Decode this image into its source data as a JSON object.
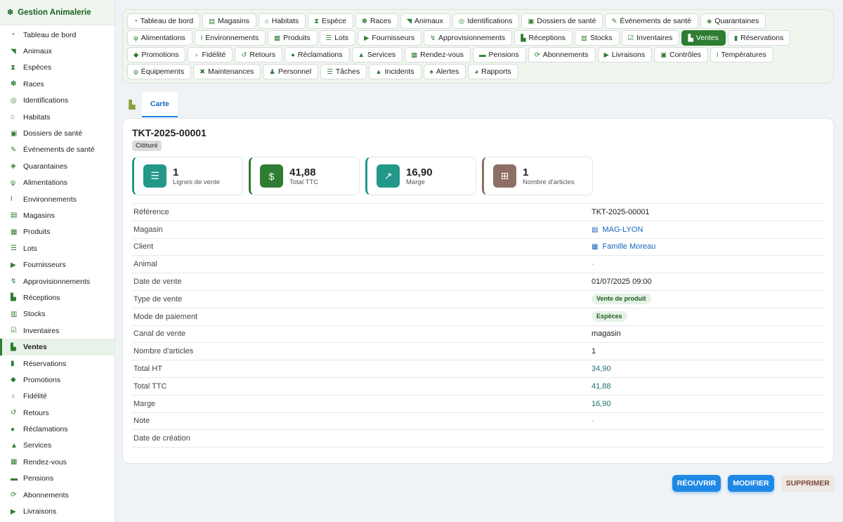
{
  "sidebar": {
    "brand": {
      "icon": "✽",
      "label": "Gestion Animalerie"
    },
    "items": [
      {
        "label": "Tableau de bord",
        "icon": "◔",
        "name": "sidebar-item-tableau-de-bord"
      },
      {
        "label": "Animaux",
        "icon": "◥",
        "name": "sidebar-item-animaux"
      },
      {
        "label": "Espèces",
        "icon": "⧗",
        "name": "sidebar-item-especes"
      },
      {
        "label": "Races",
        "icon": "✽",
        "name": "sidebar-item-races"
      },
      {
        "label": "Identifications",
        "icon": "◎",
        "name": "sidebar-item-identifications"
      },
      {
        "label": "Habitats",
        "icon": "⌂",
        "name": "sidebar-item-habitats"
      },
      {
        "label": "Dossiers de santé",
        "icon": "▣",
        "name": "sidebar-item-dossiers-de-sante"
      },
      {
        "label": "Événements de santé",
        "icon": "✎",
        "name": "sidebar-item-evenements-de-sante"
      },
      {
        "label": "Quarantaines",
        "icon": "◈",
        "name": "sidebar-item-quarantaines"
      },
      {
        "label": "Alimentations",
        "icon": "ψ",
        "name": "sidebar-item-alimentations"
      },
      {
        "label": "Environnements",
        "icon": "ǀ",
        "name": "sidebar-item-environnements"
      },
      {
        "label": "Magasins",
        "icon": "▤",
        "name": "sidebar-item-magasins"
      },
      {
        "label": "Produits",
        "icon": "▦",
        "name": "sidebar-item-produits"
      },
      {
        "label": "Lots",
        "icon": "☰",
        "name": "sidebar-item-lots"
      },
      {
        "label": "Fournisseurs",
        "icon": "▶",
        "name": "sidebar-item-fournisseurs"
      },
      {
        "label": "Approvisionnements",
        "icon": "↯",
        "name": "sidebar-item-approvisionnements"
      },
      {
        "label": "Réceptions",
        "icon": "▙",
        "name": "sidebar-item-receptions"
      },
      {
        "label": "Stocks",
        "icon": "▥",
        "name": "sidebar-item-stocks"
      },
      {
        "label": "Inventaires",
        "icon": "☑",
        "name": "sidebar-item-inventaires"
      },
      {
        "label": "Ventes",
        "icon": "▙",
        "name": "sidebar-item-ventes",
        "active": true
      },
      {
        "label": "Réservations",
        "icon": "▮",
        "name": "sidebar-item-reservations"
      },
      {
        "label": "Promotions",
        "icon": "◆",
        "name": "sidebar-item-promotions"
      },
      {
        "label": "Fidélité",
        "icon": "♁",
        "name": "sidebar-item-fidelite"
      },
      {
        "label": "Retours",
        "icon": "↺",
        "name": "sidebar-item-retours"
      },
      {
        "label": "Réclamations",
        "icon": "●",
        "name": "sidebar-item-reclamations"
      },
      {
        "label": "Services",
        "icon": "▲",
        "name": "sidebar-item-services"
      },
      {
        "label": "Rendez-vous",
        "icon": "▦",
        "name": "sidebar-item-rendez-vous"
      },
      {
        "label": "Pensions",
        "icon": "▬",
        "name": "sidebar-item-pensions"
      },
      {
        "label": "Abonnements",
        "icon": "⟳",
        "name": "sidebar-item-abonnements"
      },
      {
        "label": "Livraisons",
        "icon": "▶",
        "name": "sidebar-item-livraisons"
      }
    ]
  },
  "chips": [
    {
      "label": "Tableau de bord",
      "icon": "◔",
      "name": "chip-tableau-de-bord"
    },
    {
      "label": "Magasins",
      "icon": "▤",
      "name": "chip-magasins"
    },
    {
      "label": "Habitats",
      "icon": "⌂",
      "name": "chip-habitats"
    },
    {
      "label": "Espèce",
      "icon": "⧗",
      "name": "chip-espece"
    },
    {
      "label": "Races",
      "icon": "✽",
      "name": "chip-races"
    },
    {
      "label": "Animaux",
      "icon": "◥",
      "name": "chip-animaux"
    },
    {
      "label": "Identifications",
      "icon": "◎",
      "name": "chip-identifications"
    },
    {
      "label": "Dossiers de santé",
      "icon": "▣",
      "name": "chip-dossiers-de-sante"
    },
    {
      "label": "Événements de santé",
      "icon": "✎",
      "name": "chip-evenements-de-sante"
    },
    {
      "label": "Quarantaines",
      "icon": "◈",
      "name": "chip-quarantaines"
    },
    {
      "label": "Alimentations",
      "icon": "ψ",
      "name": "chip-alimentations"
    },
    {
      "label": "Environnements",
      "icon": "ǀ",
      "name": "chip-environnements"
    },
    {
      "label": "Produits",
      "icon": "▦",
      "name": "chip-produits"
    },
    {
      "label": "Lots",
      "icon": "☰",
      "name": "chip-lots"
    },
    {
      "label": "Fournisseurs",
      "icon": "▶",
      "name": "chip-fournisseurs"
    },
    {
      "label": "Approvisionnements",
      "icon": "↯",
      "name": "chip-approvisionnements"
    },
    {
      "label": "Réceptions",
      "icon": "▙",
      "name": "chip-receptions"
    },
    {
      "label": "Stocks",
      "icon": "▥",
      "name": "chip-stocks"
    },
    {
      "label": "Inventaires",
      "icon": "☑",
      "name": "chip-inventaires"
    },
    {
      "label": "Ventes",
      "icon": "▙",
      "name": "chip-ventes",
      "active": true
    },
    {
      "label": "Réservations",
      "icon": "▮",
      "name": "chip-reservations"
    },
    {
      "label": "Promotions",
      "icon": "◆",
      "name": "chip-promotions"
    },
    {
      "label": "Fidélité",
      "icon": "♁",
      "name": "chip-fidelite"
    },
    {
      "label": "Retours",
      "icon": "↺",
      "name": "chip-retours"
    },
    {
      "label": "Réclamations",
      "icon": "●",
      "name": "chip-reclamations"
    },
    {
      "label": "Services",
      "icon": "▲",
      "name": "chip-services"
    },
    {
      "label": "Rendez-vous",
      "icon": "▦",
      "name": "chip-rendez-vous"
    },
    {
      "label": "Pensions",
      "icon": "▬",
      "name": "chip-pensions"
    },
    {
      "label": "Abonnements",
      "icon": "⟳",
      "name": "chip-abonnements"
    },
    {
      "label": "Livraisons",
      "icon": "▶",
      "name": "chip-livraisons"
    },
    {
      "label": "Contrôles",
      "icon": "▣",
      "name": "chip-controles"
    },
    {
      "label": "Températures",
      "icon": "ǀ",
      "name": "chip-temperatures"
    },
    {
      "label": "Équipements",
      "icon": "ψ",
      "name": "chip-equipements"
    },
    {
      "label": "Maintenances",
      "icon": "✖",
      "name": "chip-maintenances"
    },
    {
      "label": "Personnel",
      "icon": "♟",
      "name": "chip-personnel"
    },
    {
      "label": "Tâches",
      "icon": "☰",
      "name": "chip-taches"
    },
    {
      "label": "Incidents",
      "icon": "▲",
      "name": "chip-incidents"
    },
    {
      "label": "Alertes",
      "icon": "♠",
      "name": "chip-alertes"
    },
    {
      "label": "Rapports",
      "icon": "◕",
      "name": "chip-rapports"
    }
  ],
  "tabs": {
    "icon": "▙",
    "carte": "Carte"
  },
  "record": {
    "title": "TKT-2025-00001",
    "status": "Clôturé",
    "kpis": [
      {
        "value": "1",
        "label": "Lignes de vente",
        "icon": "☰",
        "icon_name": "list-icon",
        "bg": "#22978a",
        "border": "#22978a"
      },
      {
        "value": "41,88",
        "label": "Total TTC",
        "icon": "$",
        "icon_name": "coins-icon",
        "bg": "#2e7d32",
        "border": "#2e7d32"
      },
      {
        "value": "16,90",
        "label": "Marge",
        "icon": "↗",
        "icon_name": "chart-line-icon",
        "bg": "#22978a",
        "border": "#22978a"
      },
      {
        "value": "1",
        "label": "Nombre d'articles",
        "icon": "⊞",
        "icon_name": "basket-icon",
        "bg": "#8d6e63",
        "border": "#8d6e63"
      }
    ],
    "rows": [
      {
        "key": "Référence",
        "value": "TKT-2025-00001",
        "type": "text"
      },
      {
        "key": "Magasin",
        "value": "MAG-LYON",
        "type": "link",
        "icon": "▤"
      },
      {
        "key": "Client",
        "value": "Famille Moreau",
        "type": "link",
        "icon": "▦"
      },
      {
        "key": "Animal",
        "value": "-",
        "type": "muted"
      },
      {
        "key": "Date de vente",
        "value": "01/07/2025 09:00",
        "type": "text"
      },
      {
        "key": "Type de vente",
        "value": "Vente de produit",
        "type": "pill"
      },
      {
        "key": "Mode de paiement",
        "value": "Espèces",
        "type": "pill"
      },
      {
        "key": "Canal de vente",
        "value": "magasin",
        "type": "text"
      },
      {
        "key": "Nombre d'articles",
        "value": "1",
        "type": "text"
      },
      {
        "key": "Total HT",
        "value": "34,90",
        "type": "teal"
      },
      {
        "key": "Total TTC",
        "value": "41,88",
        "type": "teal"
      },
      {
        "key": "Marge",
        "value": "16,90",
        "type": "teal"
      },
      {
        "key": "Note",
        "value": "-",
        "type": "muted"
      },
      {
        "key": "Date de création",
        "value": "",
        "type": "text"
      }
    ]
  },
  "actions": {
    "reopen": "RÉOUVRIR",
    "edit": "MODIFIER",
    "delete": "SUPPRIMER"
  }
}
